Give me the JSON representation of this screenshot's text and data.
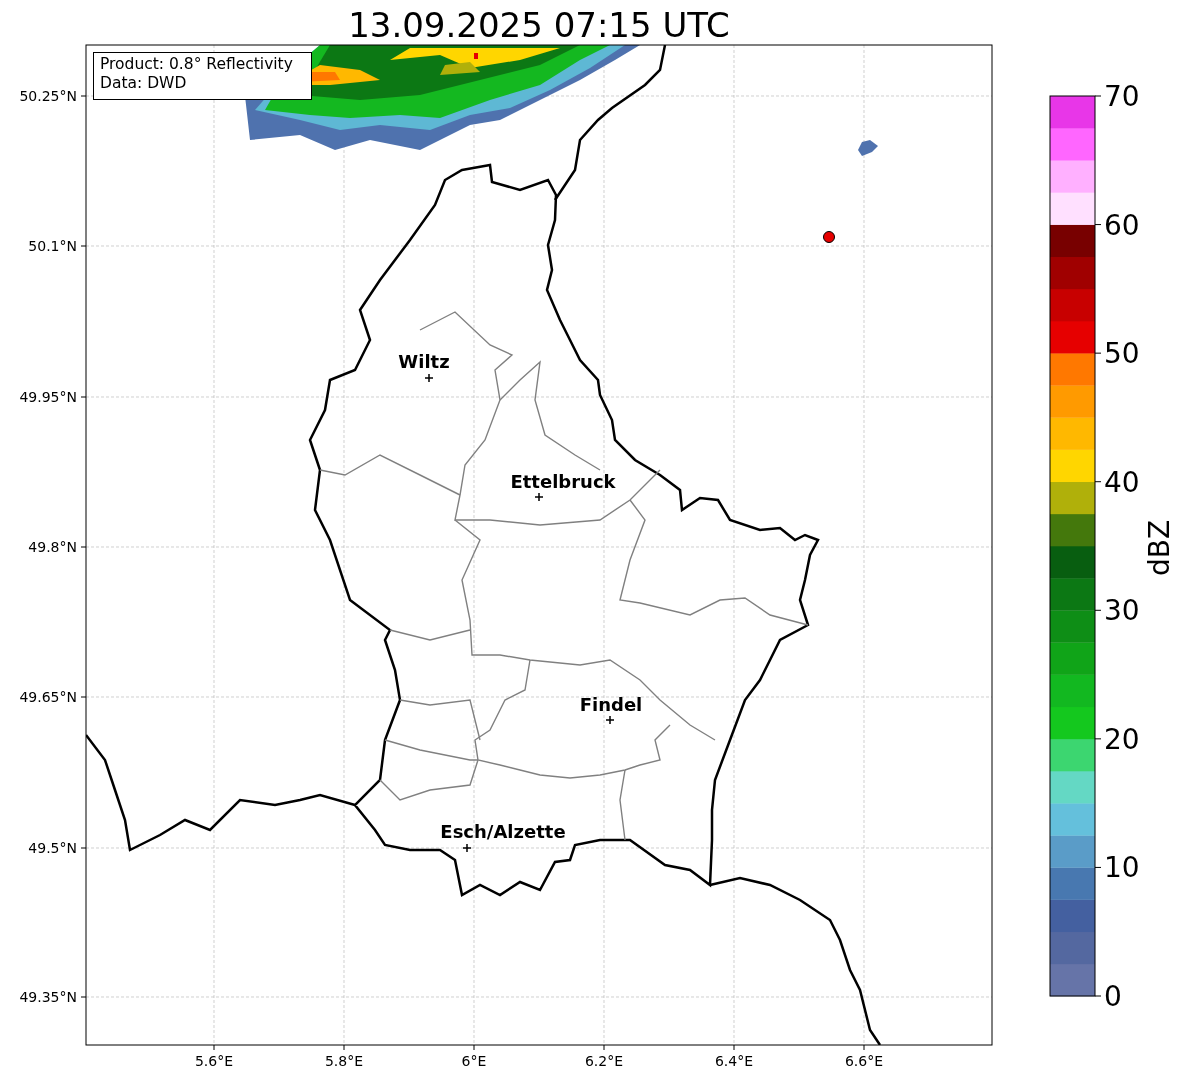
{
  "title": "13.09.2025 07:15 UTC",
  "info_box": [
    "Product: 0.8° Reflectivity",
    "Data: DWD"
  ],
  "map": {
    "x_ticks": [
      "5.6°E",
      "5.8°E",
      "6°E",
      "6.2°E",
      "6.4°E",
      "6.6°E"
    ],
    "y_ticks": [
      "50.25°N",
      "50.1°N",
      "49.95°N",
      "49.8°N",
      "49.65°N",
      "49.5°N",
      "49.35°N"
    ],
    "cities": [
      {
        "name": "Wiltz"
      },
      {
        "name": "Ettelbruck"
      },
      {
        "name": "Findel"
      },
      {
        "name": "Esch/Alzette"
      }
    ],
    "radar_site_marker": {
      "color": "#e60000"
    }
  },
  "colorbar": {
    "label": "dBZ",
    "ticks": [
      "70",
      "60",
      "50",
      "40",
      "30",
      "20",
      "10",
      "0"
    ],
    "bands": [
      {
        "color": "#6674a8"
      },
      {
        "color": "#5468a0"
      },
      {
        "color": "#4460a0"
      },
      {
        "color": "#4878b0"
      },
      {
        "color": "#5a9cc8"
      },
      {
        "color": "#64c0dc"
      },
      {
        "color": "#64d8c4"
      },
      {
        "color": "#3cd670"
      },
      {
        "color": "#14c81e"
      },
      {
        "color": "#12b820"
      },
      {
        "color": "#10a418"
      },
      {
        "color": "#0e8e16"
      },
      {
        "color": "#0c7814"
      },
      {
        "color": "#085e10"
      },
      {
        "color": "#44780c"
      },
      {
        "color": "#b0b00a"
      },
      {
        "color": "#ffd600"
      },
      {
        "color": "#ffb800"
      },
      {
        "color": "#ff9a00"
      },
      {
        "color": "#ff7800"
      },
      {
        "color": "#e60000"
      },
      {
        "color": "#c80000"
      },
      {
        "color": "#a00000"
      },
      {
        "color": "#780000"
      },
      {
        "color": "#ffe0ff"
      },
      {
        "color": "#ffb0ff"
      },
      {
        "color": "#ff66ff"
      },
      {
        "color": "#e836e8"
      }
    ]
  }
}
